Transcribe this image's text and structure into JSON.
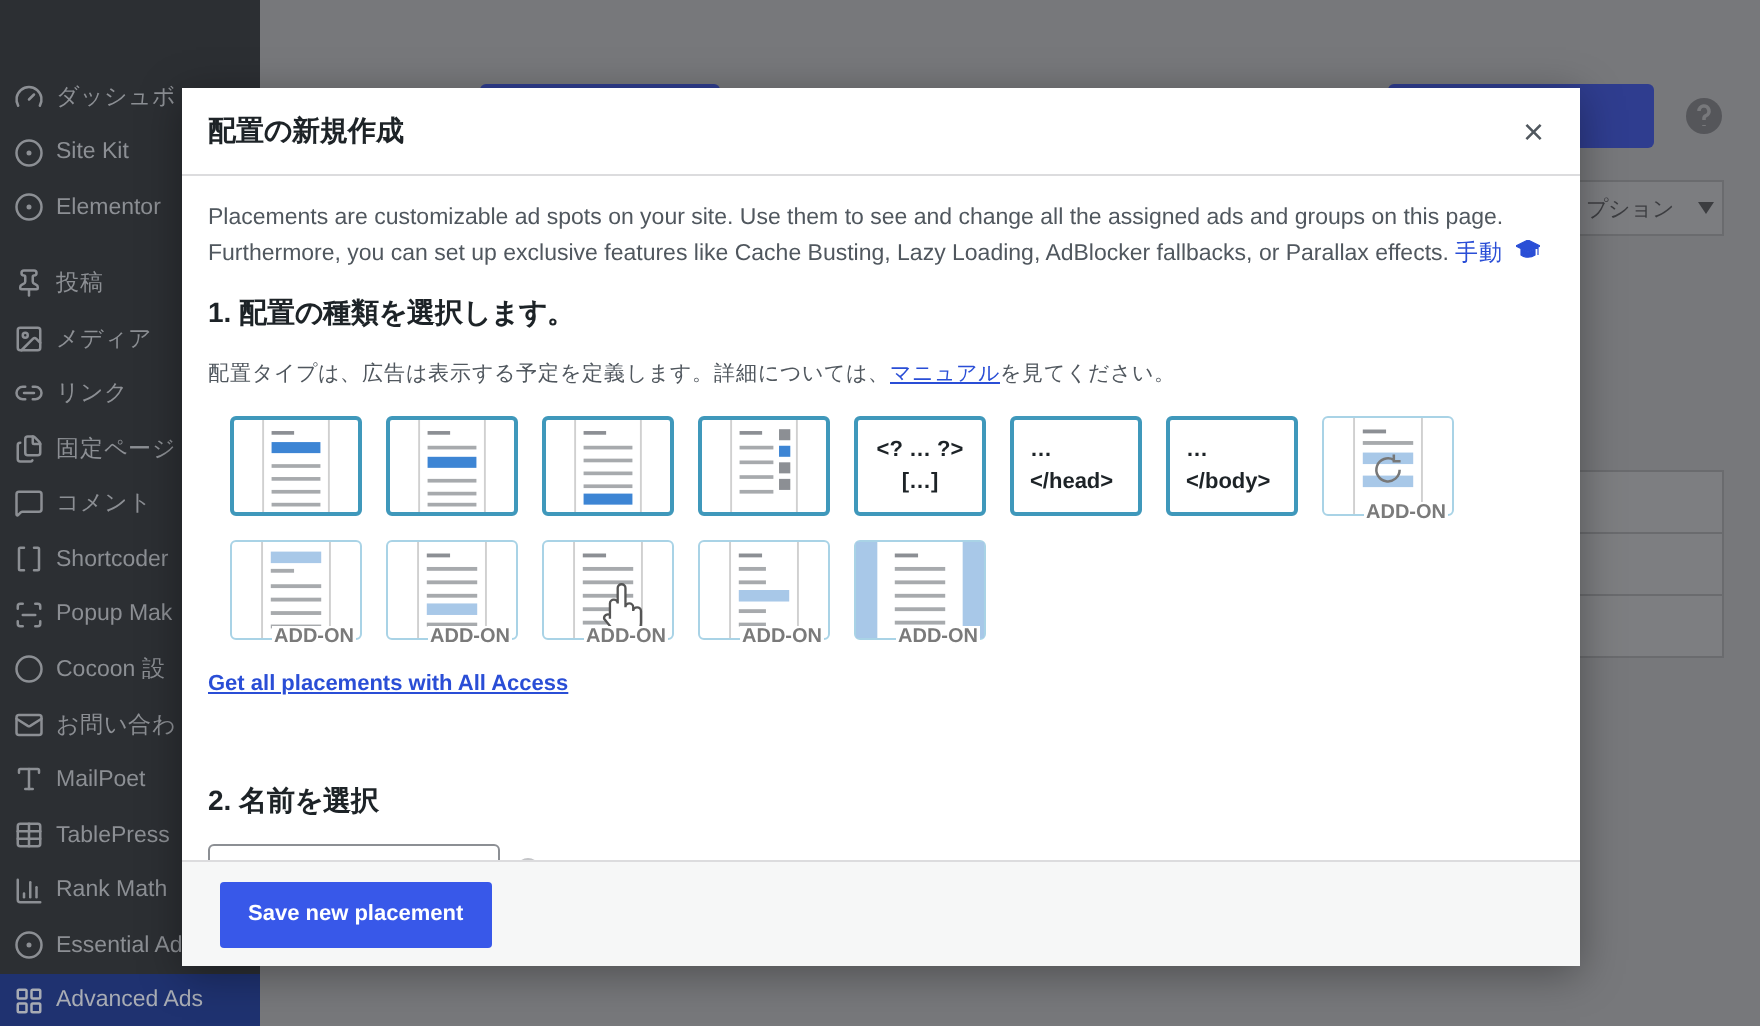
{
  "sidebar": {
    "groups": [
      [
        {
          "label": "ダッシュボ",
          "selected": false
        },
        {
          "label": "Site Kit",
          "selected": false
        },
        {
          "label": "Elementor",
          "selected": false
        }
      ],
      [
        {
          "label": "投稿",
          "selected": false
        },
        {
          "label": "メディア",
          "selected": false
        },
        {
          "label": "リンク",
          "selected": false
        },
        {
          "label": "固定ページ",
          "selected": false
        },
        {
          "label": "コメント",
          "selected": false
        },
        {
          "label": "Shortcoder",
          "selected": false
        },
        {
          "label": "Popup Mak",
          "selected": false
        },
        {
          "label": "Cocoon 設",
          "selected": false
        },
        {
          "label": "お問い合わ",
          "selected": false
        },
        {
          "label": "MailPoet",
          "selected": false
        },
        {
          "label": "TablePress",
          "selected": false
        },
        {
          "label": "Rank Math",
          "selected": false
        },
        {
          "label": "Essential Ad",
          "selected": false
        },
        {
          "label": "Advanced Ads",
          "selected": true
        }
      ]
    ]
  },
  "background": {
    "select": {
      "value": "プション"
    }
  },
  "modal": {
    "title": "配置の新規作成",
    "close": "×",
    "intro": {
      "text": "Placements are customizable ad spots on your site. Use them to see and change all the assigned ads and groups on this page. Furthermore, you can set up exclusive features like Cache Busting, Lazy Loading, AdBlocker fallbacks, or Parallax effects.",
      "link": "手動"
    },
    "step1": {
      "heading": "1. 配置の種類を選択します。",
      "before": "配置タイプは、広告は表示する予定を定義します。詳細については、",
      "link": "マニュアル",
      "after": "を見てください。"
    },
    "tiles": [
      {
        "kind": "top",
        "selected": false
      },
      {
        "kind": "middle",
        "selected": false
      },
      {
        "kind": "bottom",
        "selected": false
      },
      {
        "kind": "sidebar",
        "selected": false
      },
      {
        "kind": "code",
        "lines": [
          "<? … ?>",
          "[…]"
        ],
        "selected": false
      },
      {
        "kind": "code",
        "lines": [
          "…",
          "</head>"
        ],
        "selected": false
      },
      {
        "kind": "code",
        "lines": [
          "…",
          "</body>"
        ],
        "selected": false
      },
      {
        "kind": "rotation",
        "badge": "ADD-ON",
        "selected": false
      },
      {
        "kind": "header-bar",
        "badge": "ADD-ON",
        "selected": false
      },
      {
        "kind": "content-bar",
        "badge": "ADD-ON",
        "selected": false
      },
      {
        "kind": "cursor",
        "badge": "ADD-ON",
        "selected": false
      },
      {
        "kind": "sidebar-bar",
        "badge": "ADD-ON",
        "selected": false
      },
      {
        "kind": "side-bars",
        "badge": "ADD-ON",
        "selected": false
      }
    ],
    "all_access_link": "Get all placements with All Access",
    "step2": {
      "heading": "2. 名前を選択"
    },
    "save_button": "Save new placement"
  }
}
